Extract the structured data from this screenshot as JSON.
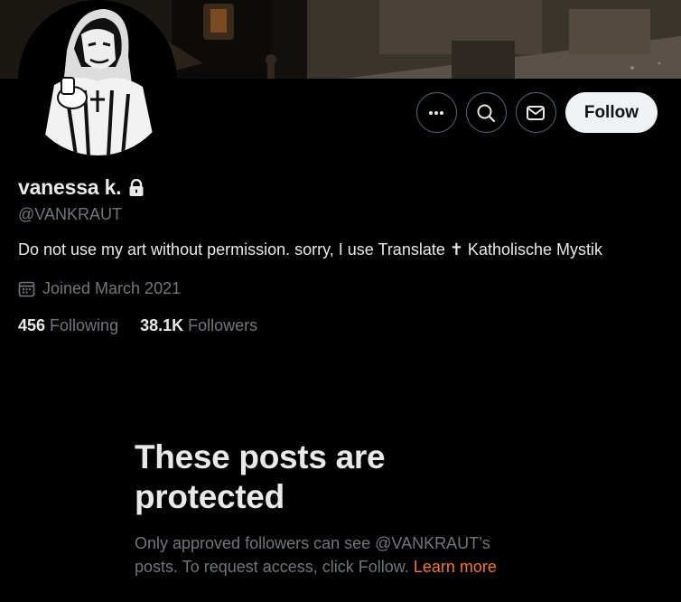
{
  "profile": {
    "display_name": "vanessa k.",
    "handle": "@VANKRAUT",
    "bio": "Do not use my art without permission. sorry, I use Translate ✝ Katholische Mystik",
    "joined": "Joined March 2021",
    "following_count": "456",
    "following_label": "Following",
    "followers_count": "38.1K",
    "followers_label": "Followers"
  },
  "actions": {
    "more_icon": "more-horizontal-icon",
    "search_icon": "search-icon",
    "message_icon": "envelope-icon",
    "follow_label": "Follow"
  },
  "protected": {
    "title": "These posts are protected",
    "description": "Only approved followers can see @VANKRAUT’s posts. To request access, click Follow.",
    "link_label": "Learn more"
  },
  "colors": {
    "background": "#000000",
    "primary_text": "#e7e9ea",
    "secondary_text": "#71767b",
    "link": "#f4762d",
    "button_bg": "#eff3f4",
    "border": "#536471"
  }
}
